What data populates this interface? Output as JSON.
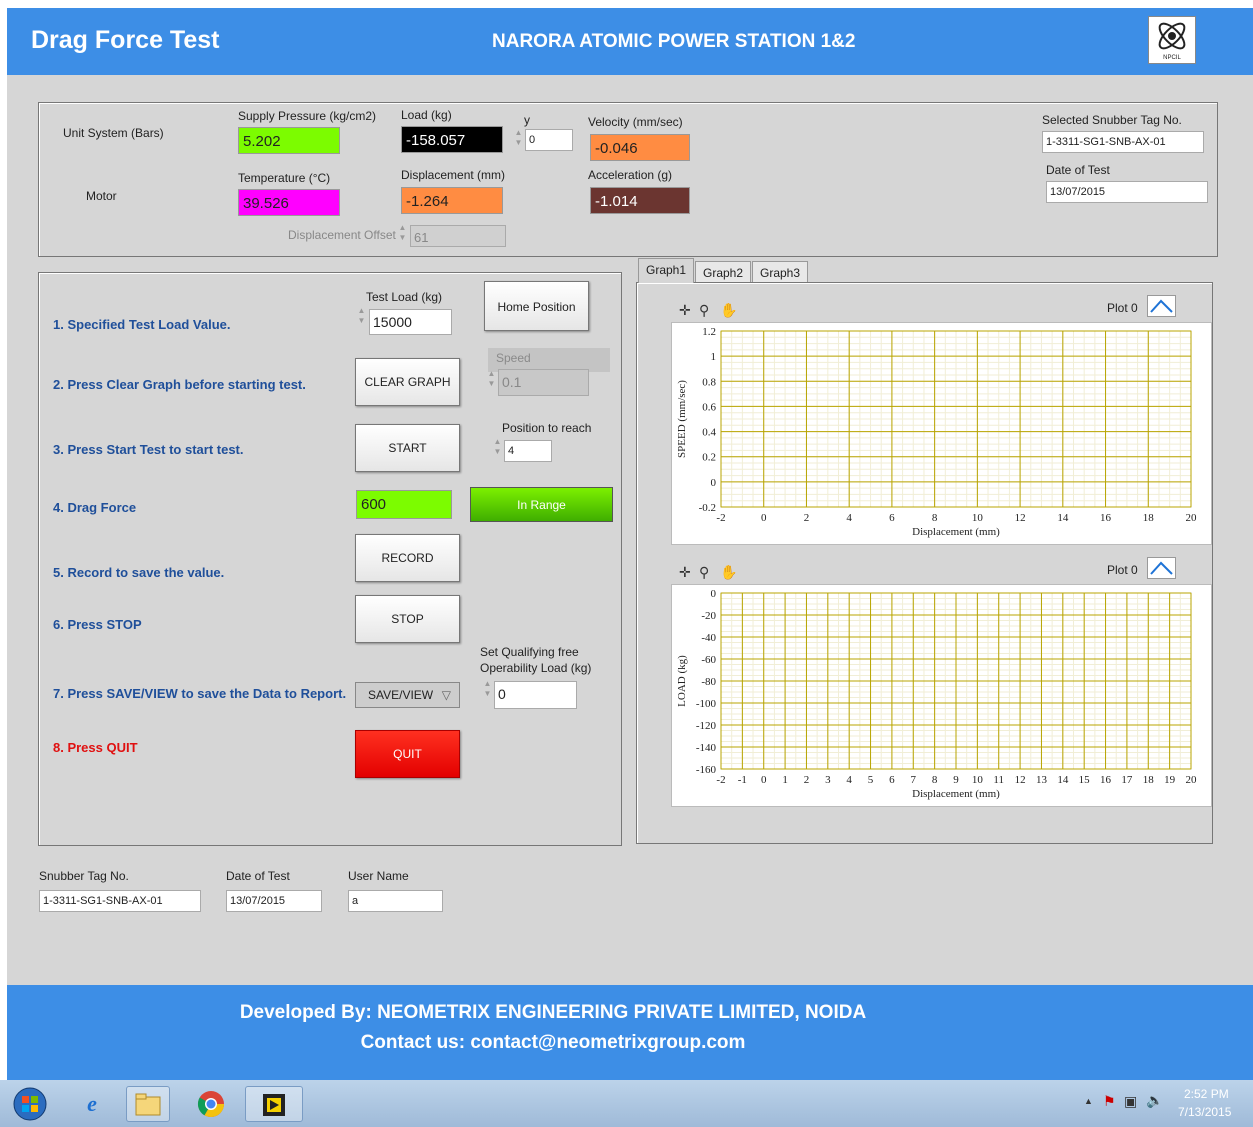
{
  "header": {
    "title": "Drag Force Test",
    "station": "NARORA ATOMIC POWER STATION 1&2",
    "logo_text": "NPCIL"
  },
  "status_panel": {
    "unit_system_label": "Unit System (Bars)",
    "motor_label": "Motor",
    "supply_pressure": {
      "label": "Supply Pressure (kg/cm2)",
      "value": "5.202",
      "color": "#7cfc00"
    },
    "temperature": {
      "label": "Temperature (°C)",
      "value": "39.526",
      "color": "#ff00ff"
    },
    "load": {
      "label": "Load (kg)",
      "value": "-158.057",
      "color": "#000000"
    },
    "y": {
      "label": "y",
      "value": "0"
    },
    "displacement": {
      "label": "Displacement (mm)",
      "value": "-1.264",
      "color": "#ff8c42"
    },
    "displacement_offset": {
      "label": "Displacement Offset",
      "value": "61"
    },
    "velocity": {
      "label": "Velocity (mm/sec)",
      "value": "-0.046",
      "color": "#ff8c42"
    },
    "acceleration": {
      "label": "Acceleration (g)",
      "value": "-1.014",
      "color": "#6b3530"
    },
    "snubber_tag": {
      "label": "Selected Snubber Tag No.",
      "value": "1-3311-SG1-SNB-AX-01"
    },
    "date_of_test": {
      "label": "Date of Test",
      "value": "13/07/2015"
    }
  },
  "steps": [
    "1. Specified Test Load Value.",
    "2. Press Clear Graph before starting test.",
    "3. Press Start Test to start test.",
    "4. Drag Force",
    "5. Record to save the value.",
    "6. Press STOP",
    "7. Press SAVE/VIEW to save the Data to Report.",
    "8. Press QUIT"
  ],
  "controls": {
    "test_load": {
      "label": "Test Load (kg)",
      "value": "15000"
    },
    "home_position": "Home Position",
    "clear_graph": "CLEAR GRAPH",
    "speed": {
      "label": "Speed",
      "value": "0.1"
    },
    "start": "START",
    "position_to_reach": {
      "label": "Position to reach",
      "value": "4"
    },
    "drag_force": {
      "value": "600",
      "status": "In Range",
      "color": "#7cfc00"
    },
    "record": "RECORD",
    "stop": "STOP",
    "qualifying_load": {
      "label_line1": "Set Qualifying free",
      "label_line2": "Operability Load (kg)",
      "value": "0"
    },
    "save_view": "SAVE/VIEW",
    "quit": "QUIT"
  },
  "tabs": [
    "Graph1",
    "Graph2",
    "Graph3"
  ],
  "graphs": {
    "plot_label": "Plot 0",
    "speed_ylabel": "SPEED (mm/sec)",
    "load_ylabel": "LOAD (kg)",
    "xlabel": "Displacement (mm)"
  },
  "chart_data": [
    {
      "type": "line",
      "xlabel": "Displacement (mm)",
      "ylabel": "SPEED (mm/sec)",
      "xlim": [
        -2,
        20
      ],
      "ylim": [
        -0.2,
        1.2
      ],
      "x_ticks": [
        "-2",
        "0",
        "2",
        "4",
        "6",
        "8",
        "10",
        "12",
        "14",
        "16",
        "18",
        "20"
      ],
      "y_ticks": [
        "1.2",
        "1",
        "0.8",
        "0.6",
        "0.4",
        "0.2",
        "0",
        "-0.2"
      ],
      "series": [
        {
          "name": "Plot 0",
          "values": []
        }
      ],
      "grid": true
    },
    {
      "type": "line",
      "xlabel": "Displacement (mm)",
      "ylabel": "LOAD (kg)",
      "xlim": [
        -2,
        20
      ],
      "ylim": [
        -160,
        0
      ],
      "x_ticks": [
        "-2",
        "-1",
        "0",
        "1",
        "2",
        "3",
        "4",
        "5",
        "6",
        "7",
        "8",
        "9",
        "10",
        "11",
        "12",
        "13",
        "14",
        "15",
        "16",
        "17",
        "18",
        "19",
        "20"
      ],
      "y_ticks": [
        "0",
        "-20",
        "-40",
        "-60",
        "-80",
        "-100",
        "-120",
        "-140",
        "-160"
      ],
      "series": [
        {
          "name": "Plot 0",
          "values": []
        }
      ],
      "grid": true
    }
  ],
  "bottom_fields": {
    "snubber_tag": {
      "label": "Snubber Tag No.",
      "value": "1-3311-SG1-SNB-AX-01"
    },
    "date_of_test": {
      "label": "Date of Test",
      "value": "13/07/2015"
    },
    "user_name": {
      "label": "User Name",
      "value": "a"
    }
  },
  "footer": {
    "developer": "Developed By: NEOMETRIX ENGINEERING PRIVATE LIMITED, NOIDA",
    "contact": "Contact us: contact@neometrixgroup.com"
  },
  "taskbar": {
    "time": "2:52 PM",
    "date": "7/13/2015",
    "icons": [
      "windows-start-icon",
      "internet-explorer-icon",
      "file-explorer-icon",
      "chrome-icon",
      "labview-app-icon"
    ]
  }
}
